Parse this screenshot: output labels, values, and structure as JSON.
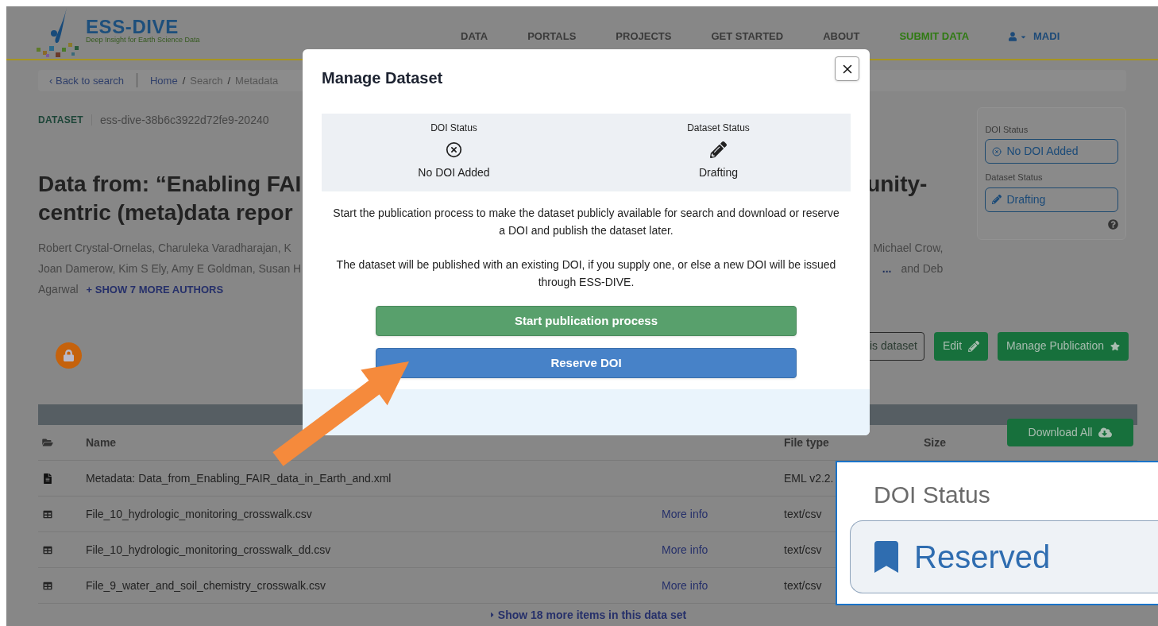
{
  "header": {
    "logo": {
      "name": "ESS-DIVE",
      "tagline": "Deep Insight for Earth Science Data"
    },
    "nav": [
      {
        "label": "DATA",
        "kind": "link"
      },
      {
        "label": "PORTALS",
        "kind": "link"
      },
      {
        "label": "PROJECTS",
        "kind": "link"
      },
      {
        "label": "GET STARTED",
        "kind": "link"
      },
      {
        "label": "ABOUT",
        "kind": "link"
      },
      {
        "label": "SUBMIT DATA",
        "kind": "highlight"
      },
      {
        "label": "MADI",
        "kind": "user"
      }
    ]
  },
  "breadcrumb": {
    "back_glyph": "‹",
    "back": "Back to search",
    "separator": "/",
    "path": [
      "Home",
      "Search",
      "Metadata"
    ]
  },
  "dataset": {
    "label": "DATASET",
    "id": "ess-dive-38b6c3922d72fe9-20240"
  },
  "title": {
    "lines": [
      {
        "left": "Data from: “Enabling FAI",
        "right": "unity-"
      },
      {
        "left": "centric (meta)data repor"
      }
    ]
  },
  "authors": {
    "lines": [
      {
        "left": "Robert Crystal-Ornelas, Charuleka Varadharajan, K",
        "right": "Michael Crow,"
      },
      {
        "left": "Joan Damerow, Kim S Ely, Amy E Goldman, Susan H",
        "ellipsis": "...",
        "right": "and Deb"
      }
    ],
    "last": "Agarwal",
    "show_more": "+ SHOW 7 MORE AUTHORS"
  },
  "status_card": {
    "items": [
      {
        "label": "DOI Status",
        "value": "No DOI Added",
        "kind": "doi"
      },
      {
        "label": "Dataset Status",
        "value": "Drafting",
        "kind": "dataset"
      }
    ]
  },
  "actions": [
    {
      "label": "is dataset",
      "kind": "outline"
    },
    {
      "label": "Edit",
      "kind": "edit"
    },
    {
      "label": "Manage Publication",
      "kind": "publish"
    }
  ],
  "table": {
    "columns": [
      "Name",
      "File type",
      "Size"
    ],
    "download": "Download All",
    "rows": [
      {
        "kind": "metadata",
        "name": "Metadata: Data_from_Enabling_FAIR_data_in_Earth_and.xml",
        "type": "EML v2.2."
      },
      {
        "kind": "csv",
        "name": "File_10_hydrologic_monitoring_crosswalk.csv",
        "info": "More info",
        "type": "text/csv"
      },
      {
        "kind": "csv",
        "name": "File_10_hydrologic_monitoring_crosswalk_dd.csv",
        "info": "More info",
        "type": "text/csv"
      },
      {
        "kind": "csv",
        "name": "File_9_water_and_soil_chemistry_crosswalk.csv",
        "info": "More info",
        "type": "text/csv"
      }
    ],
    "show_more": "Show 18 more items in this data set"
  },
  "modal": {
    "title": "Manage Dataset",
    "status": [
      {
        "label": "DOI Status",
        "value": "No DOI Added",
        "kind": "doi"
      },
      {
        "label": "Dataset Status",
        "value": "Drafting",
        "kind": "dataset"
      }
    ],
    "paragraphs": [
      "Start the publication process to make the dataset publicly available for search and download or reserve a DOI and publish the dataset later.",
      "The dataset will be published with an existing DOI, if you supply one, or else a new DOI will be issued through ESS-DIVE."
    ],
    "buttons": [
      {
        "label": "Start publication process",
        "kind": "primary"
      },
      {
        "label": "Reserve DOI",
        "kind": "secondary"
      }
    ]
  },
  "callout": {
    "label": "DOI Status",
    "value": "Reserved"
  }
}
